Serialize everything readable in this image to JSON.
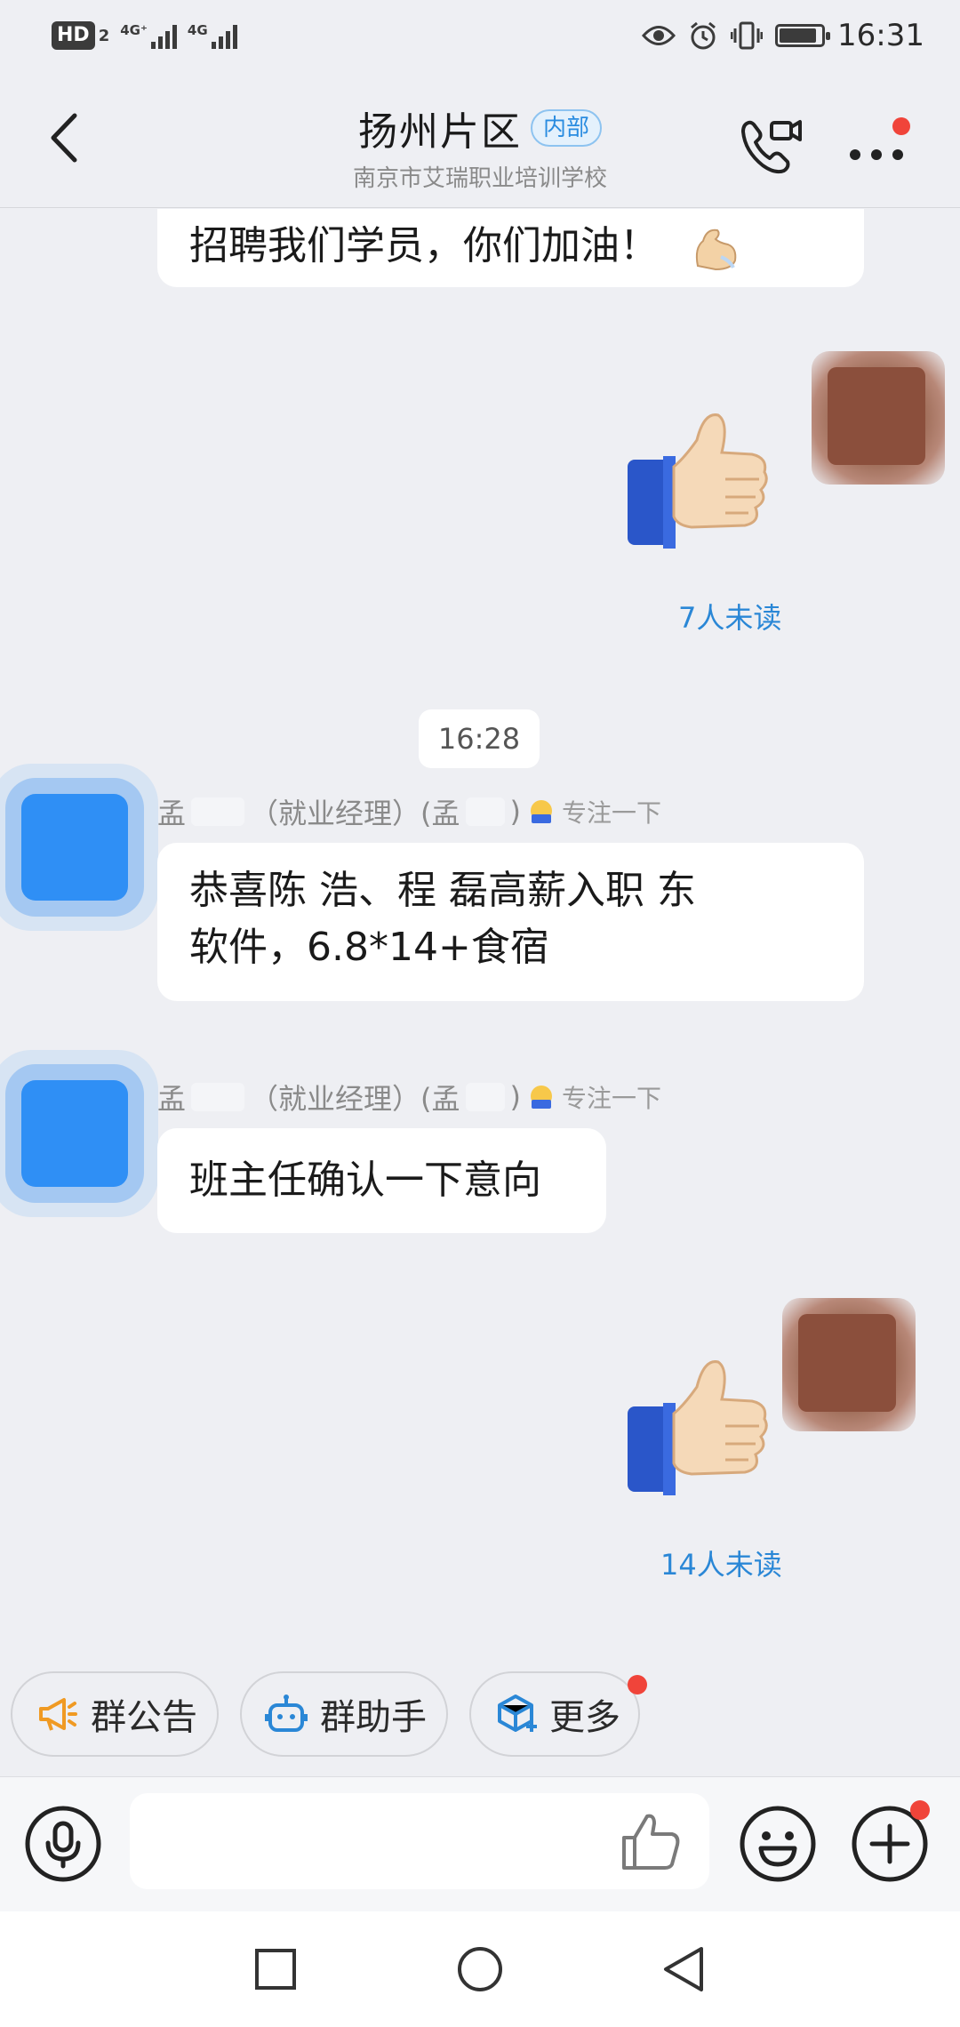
{
  "status_bar": {
    "hd": "HD",
    "hd_sub": "2",
    "net1": "4G⁺",
    "net2": "4G",
    "time": "16:31",
    "battery_level": 0.85
  },
  "header": {
    "title": "扬州片区",
    "tag": "内部",
    "subtitle": "南京市艾瑞职业培训学校"
  },
  "messages": {
    "m1_text": "招聘我们学员，你们加油！",
    "m2_unread": "7人未读",
    "time_divider": "16:28",
    "m3_sender": "孟",
    "m3_sender_role": "（就业经理）(孟",
    "m3_sender_tail": ")",
    "m3_status": "专注一下",
    "m3_line1": "恭喜陈  浩、程   磊高薪入职  东",
    "m3_line2": "软件，6.8*14+食宿",
    "m4_sender": "孟",
    "m4_sender_role": "（就业经理）(孟",
    "m4_sender_tail": ")",
    "m4_status": "专注一下",
    "m4_text": "班主任确认一下意向",
    "m5_unread": "14人未读"
  },
  "quick_actions": {
    "announcement": "群公告",
    "assistant": "群助手",
    "more": "更多"
  },
  "input": {
    "placeholder": ""
  },
  "colors": {
    "accent": "#2a87d6",
    "badge": "#f0443a",
    "background": "#eeeff3"
  }
}
